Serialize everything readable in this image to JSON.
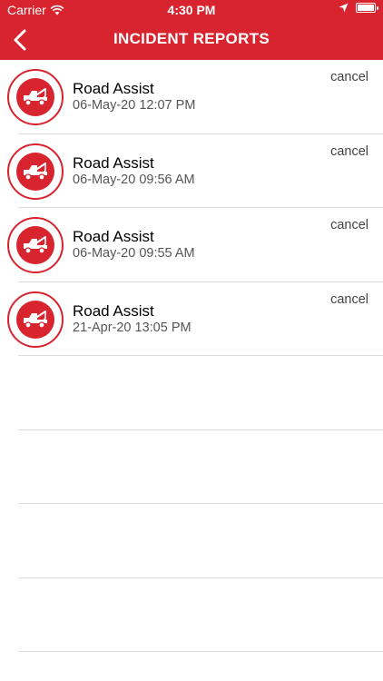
{
  "status": {
    "carrier": "Carrier",
    "time": "4:30 PM"
  },
  "nav": {
    "title": "INCIDENT REPORTS"
  },
  "incidents": [
    {
      "title": "Road Assist",
      "date": "06-May-20 12:07 PM",
      "action": "cancel"
    },
    {
      "title": "Road Assist",
      "date": "06-May-20 09:56 AM",
      "action": "cancel"
    },
    {
      "title": "Road Assist",
      "date": "06-May-20 09:55 AM",
      "action": "cancel"
    },
    {
      "title": "Road Assist",
      "date": "21-Apr-20 13:05 PM",
      "action": "cancel"
    }
  ],
  "colors": {
    "brand": "#d7242f",
    "separator": "#dcdcdc"
  }
}
